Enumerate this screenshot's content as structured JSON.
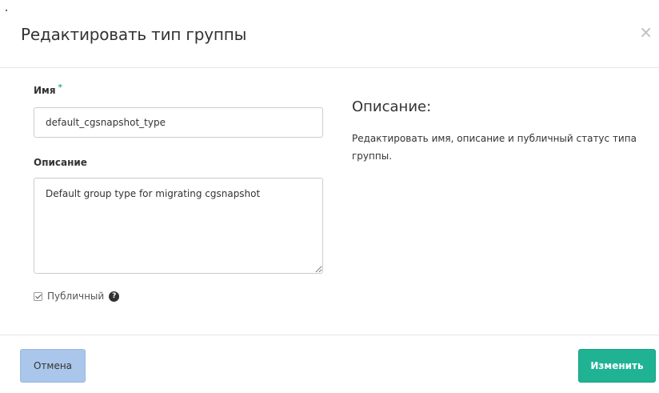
{
  "modal": {
    "title": "Редактировать тип группы",
    "close_icon": "×"
  },
  "form": {
    "name_label": "Имя",
    "required_marker": "*",
    "name_value": "default_cgsnapshot_type",
    "description_label": "Описание",
    "description_value": "Default group type for migrating cgsnapshot",
    "public_label": "Публичный",
    "public_checked": true,
    "help_icon": "?"
  },
  "sidebar": {
    "title": "Описание:",
    "text": "Редактировать имя, описание и публичный статус типа группы."
  },
  "footer": {
    "cancel_label": "Отмена",
    "submit_label": "Изменить"
  },
  "colors": {
    "accent": "#1fb393",
    "cancel_bg": "#aac6ea"
  }
}
